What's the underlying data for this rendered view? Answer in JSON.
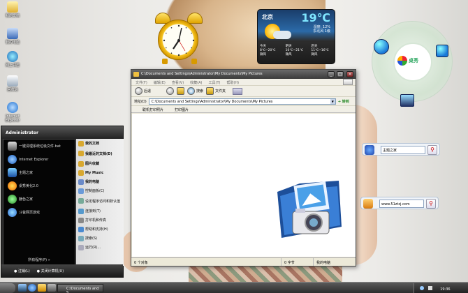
{
  "desktop_icons": [
    {
      "label": "我的文档"
    },
    {
      "label": "我的电脑"
    },
    {
      "label": "网上邻居"
    },
    {
      "label": "回收站"
    },
    {
      "label": "Internet Explorer"
    }
  ],
  "weather": {
    "city": "北京",
    "temp": "19℃",
    "humidity": "湿度: 12%",
    "wind_dir": "东北风 1级",
    "days": [
      {
        "name": "今天",
        "range": "8℃~20℃",
        "wind": "微风"
      },
      {
        "name": "明天",
        "range": "10℃~21℃",
        "wind": "微风"
      },
      {
        "name": "后天",
        "range": "11℃~16℃",
        "wind": "微风"
      }
    ]
  },
  "dock": {
    "logo_text": "桌秀"
  },
  "search_widgets": [
    {
      "value": "主题之家"
    },
    {
      "value": "www.51ztzj.com"
    }
  ],
  "explorer": {
    "title": "C:\\Documents and Settings\\Administrator\\My Documents\\My Pictures",
    "menu": [
      "文件(F)",
      "编辑(E)",
      "查看(V)",
      "收藏(A)",
      "工具(T)",
      "帮助(H)"
    ],
    "toolbar": {
      "back": "后退",
      "search": "搜索",
      "folders": "文件夹"
    },
    "address_label": "地址(D)",
    "address_value": "C:\\Documents and Settings\\Administrator\\My Documents\\My Pictures",
    "go_label": "转到",
    "links": [
      "联机打印照片",
      "打印图片"
    ],
    "status": {
      "objects": "0 个对象",
      "size": "0 字节",
      "location": "我的电脑"
    }
  },
  "start_menu": {
    "user": "Administrator",
    "left_items": [
      "一键清理系统垃圾文件.bat",
      "Internet Explorer",
      "主题之家",
      "桌秀美化2.0",
      "魅色之家",
      "斗爸网页游戏"
    ],
    "right_items": [
      "我的文档",
      "我最近的文档(D)",
      "图片收藏",
      "My Music",
      "我的电脑",
      "控制面板(C)",
      "设定程序访问和默认值",
      "连接到(T)",
      "打印机和传真",
      "帮助和支持(H)",
      "搜索(S)",
      "运行(R)..."
    ],
    "all_programs": "所有程序(P)",
    "logoff": "注销(L)",
    "shutdown": "关闭计算机(U)"
  },
  "taskbar": {
    "task_label": "C:\\Documents and S...",
    "clock": "19:36"
  }
}
